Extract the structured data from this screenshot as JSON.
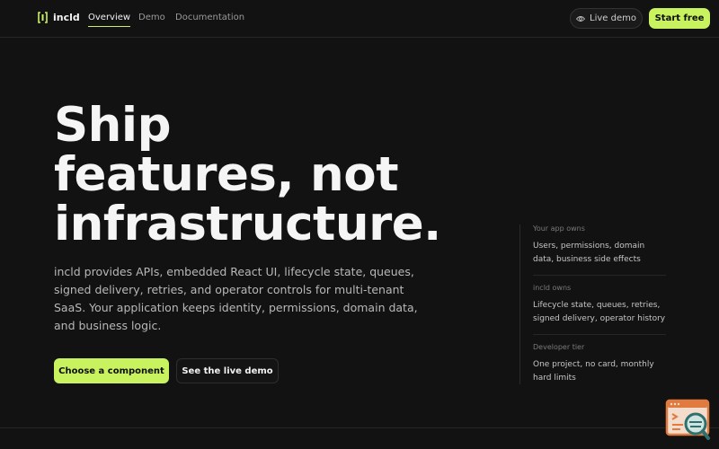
{
  "nav": {
    "brand": "incld",
    "links": [
      {
        "label": "Overview",
        "active": true
      },
      {
        "label": "Demo",
        "active": false
      },
      {
        "label": "Documentation",
        "active": false
      }
    ],
    "live_demo_label": "Live demo",
    "start_label": "Start free"
  },
  "hero": {
    "title_lines": [
      "Ship",
      "features, not",
      "infrastructure."
    ],
    "description": "incld provides APIs, embedded React UI, lifecycle state, queues, signed delivery, retries, and operator controls for multi-tenant SaaS. Your application keeps identity, permissions, domain data, and business logic.",
    "primary_cta": "Choose a component",
    "secondary_cta": "See the live demo"
  },
  "side": {
    "items": [
      {
        "label": "Your app owns",
        "text": "Users, permissions, domain data, business side effects"
      },
      {
        "label": "incld owns",
        "text": "Lifecycle state, queues, retries, signed delivery, operator history"
      },
      {
        "label": "Developer tier",
        "text": "One project, no card, monthly hard limits"
      }
    ]
  },
  "colors": {
    "background": "#121212",
    "accent": "#c9f25f",
    "widget_orange": "#e07a3f",
    "widget_teal": "#2f6f6d"
  },
  "icons": {
    "brand": "bracket-logo-icon",
    "live_demo": "eye-icon",
    "widget": "inspector-widget-icon"
  }
}
